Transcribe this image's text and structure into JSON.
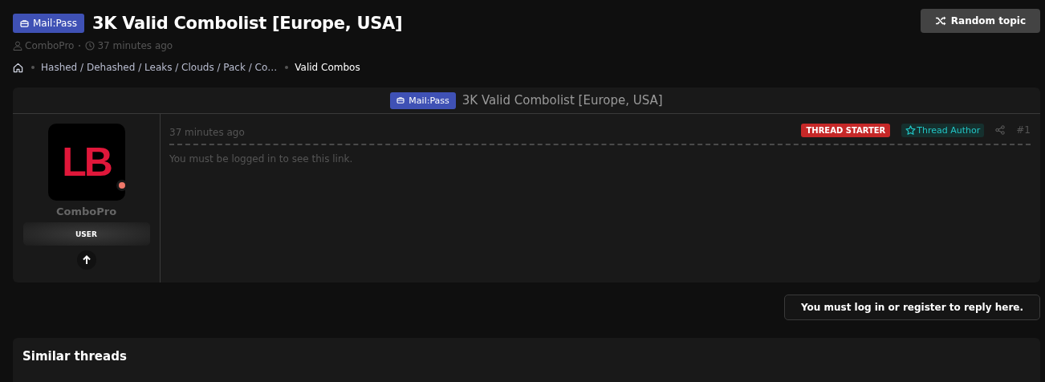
{
  "thread": {
    "prefix": "Mail:Pass",
    "title": "3K Valid Combolist [Europe, USA]",
    "author": "ComboPro",
    "time": "37 minutes ago"
  },
  "random_button": {
    "label": "Random topic"
  },
  "breadcrumbs": [
    {
      "label": "Hashed / Dehashed / Leaks / Clouds / Pack / Co…",
      "current": false
    },
    {
      "label": "Valid Combos",
      "current": true
    }
  ],
  "post": {
    "prefix": "Mail:Pass",
    "title": "3K Valid Combolist [Europe, USA]",
    "user": {
      "avatar_text": "LB",
      "name": "ComboPro",
      "role": "USER",
      "online": true
    },
    "time": "37 minutes ago",
    "badges": [
      {
        "kind": "starter",
        "label": "THREAD STARTER"
      },
      {
        "kind": "author",
        "label": "Thread Author"
      }
    ],
    "number": "#1",
    "body": "You must be logged in to see this link."
  },
  "reply_notice": "You must log in or register to reply here.",
  "similar": {
    "title": "Similar threads"
  }
}
